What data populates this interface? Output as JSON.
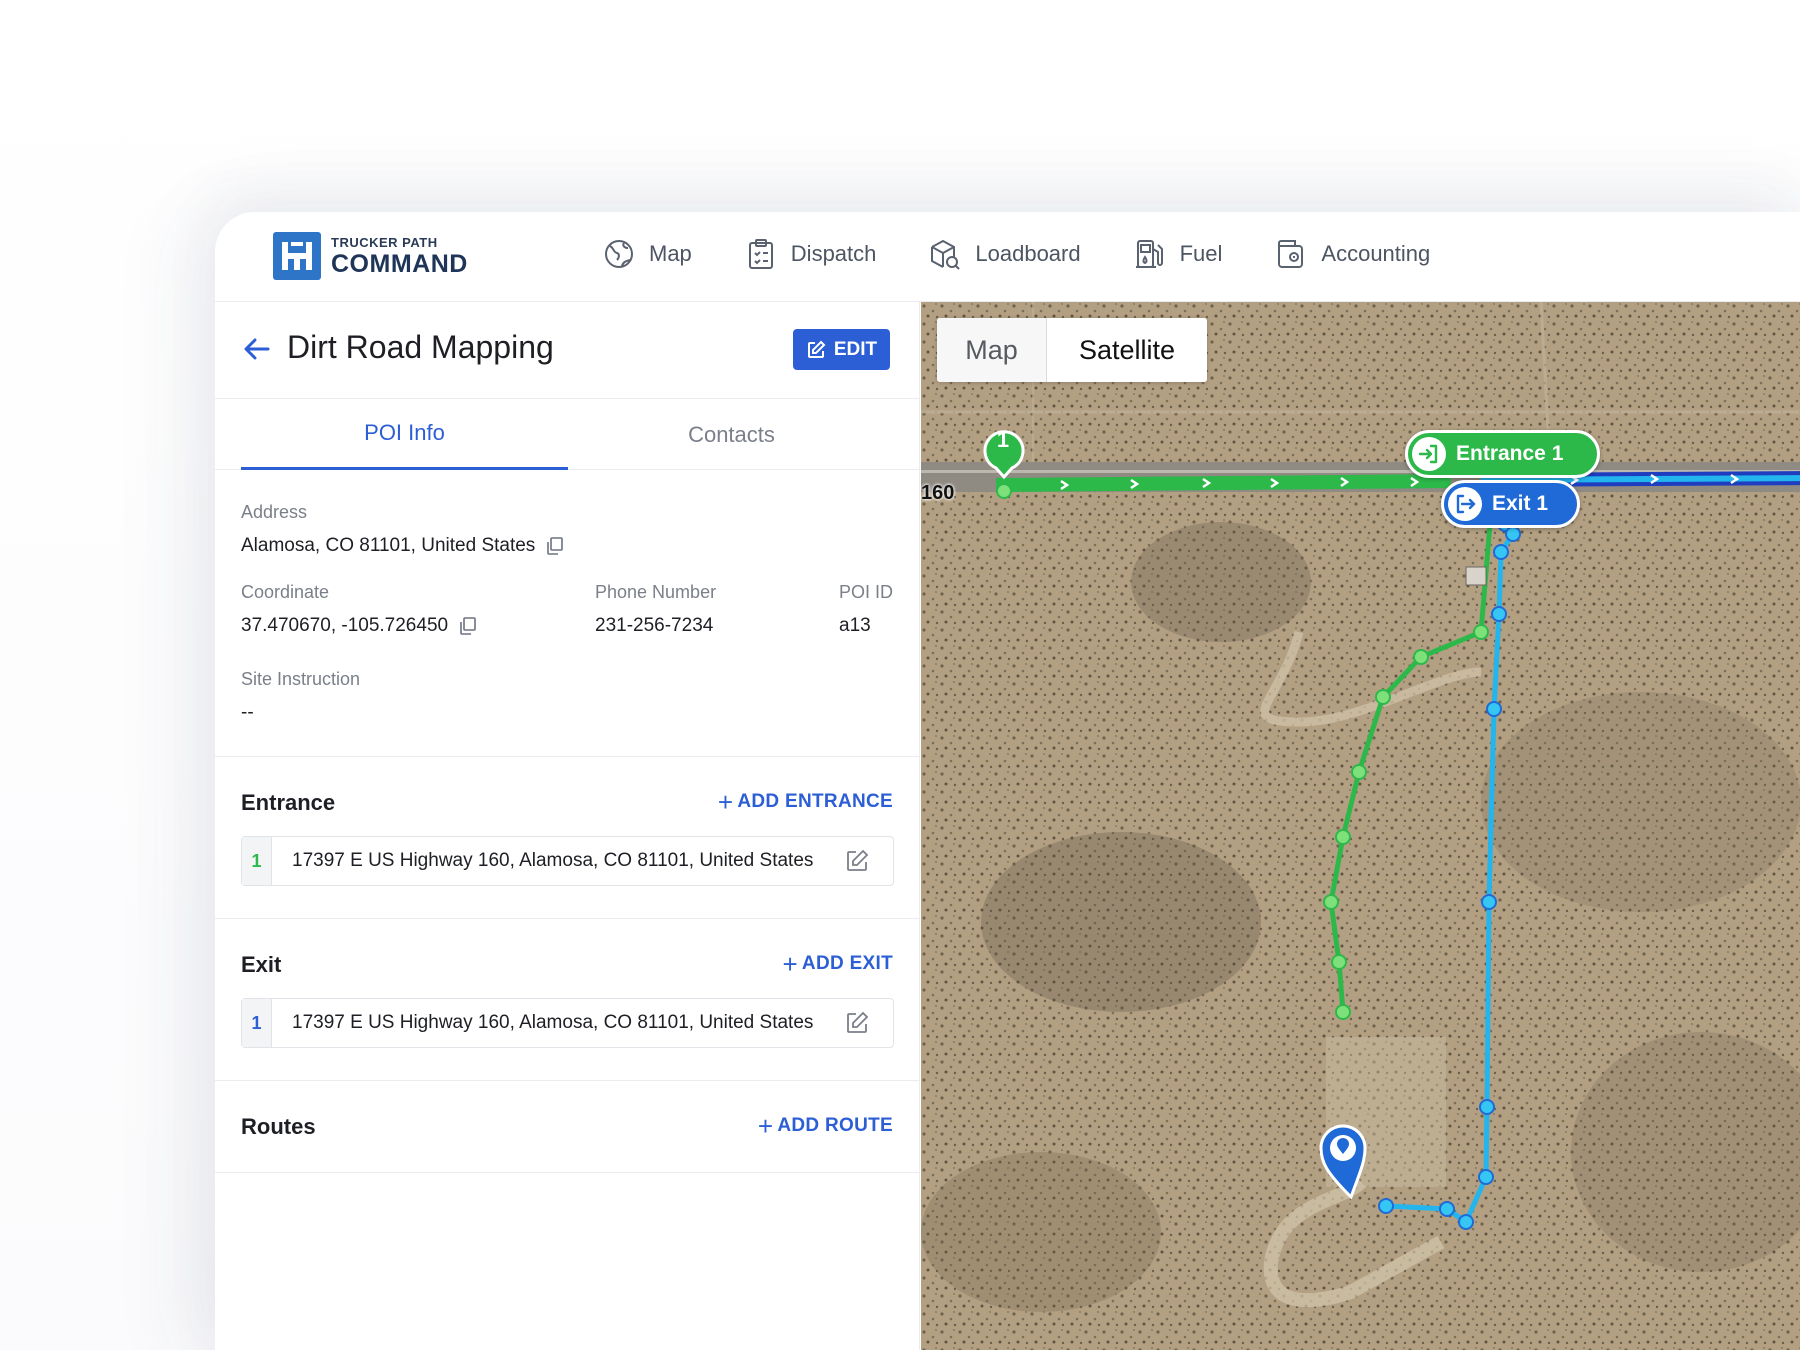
{
  "app": {
    "logo_small": "TRUCKER PATH",
    "logo_big": "COMMAND",
    "brand_color": "#2f75c7"
  },
  "nav": {
    "items": [
      {
        "label": "Map",
        "icon": "globe-icon"
      },
      {
        "label": "Dispatch",
        "icon": "clipboard-icon"
      },
      {
        "label": "Loadboard",
        "icon": "box-search-icon"
      },
      {
        "label": "Fuel",
        "icon": "fuel-pump-icon"
      },
      {
        "label": "Accounting",
        "icon": "wallet-icon"
      }
    ]
  },
  "panel": {
    "title": "Dirt Road Mapping",
    "edit_label": "EDIT",
    "tabs": [
      {
        "label": "POI Info",
        "active": true
      },
      {
        "label": "Contacts",
        "active": false
      }
    ],
    "address_label": "Address",
    "address_value": "Alamosa, CO 81101, United States",
    "coordinate_label": "Coordinate",
    "coordinate_value": "37.470670, -105.726450",
    "phone_label": "Phone Number",
    "phone_value": "231-256-7234",
    "poi_id_label": "POI ID",
    "poi_id_value": "a13",
    "site_instruction_label": "Site Instruction",
    "site_instruction_value": "--",
    "entrance": {
      "title": "Entrance",
      "add_label": "ADD ENTRANCE",
      "items": [
        {
          "num": "1",
          "address": "17397 E US Highway 160, Alamosa, CO 81101, United States"
        }
      ]
    },
    "exit": {
      "title": "Exit",
      "add_label": "ADD EXIT",
      "items": [
        {
          "num": "1",
          "address": "17397 E US Highway 160, Alamosa, CO 81101, United States"
        }
      ]
    },
    "routes": {
      "title": "Routes",
      "add_label": "ADD ROUTE"
    }
  },
  "map": {
    "toggle_map": "Map",
    "toggle_satellite": "Satellite",
    "selected_view": "Satellite",
    "road_label": "160",
    "entrance_marker": "Entrance 1",
    "exit_marker": "Exit 1",
    "entrance_pin_number": "1",
    "entrance_color": "#2db84a",
    "exit_color": "#1f6ad6",
    "exit_route_color": "#23b5ee"
  }
}
